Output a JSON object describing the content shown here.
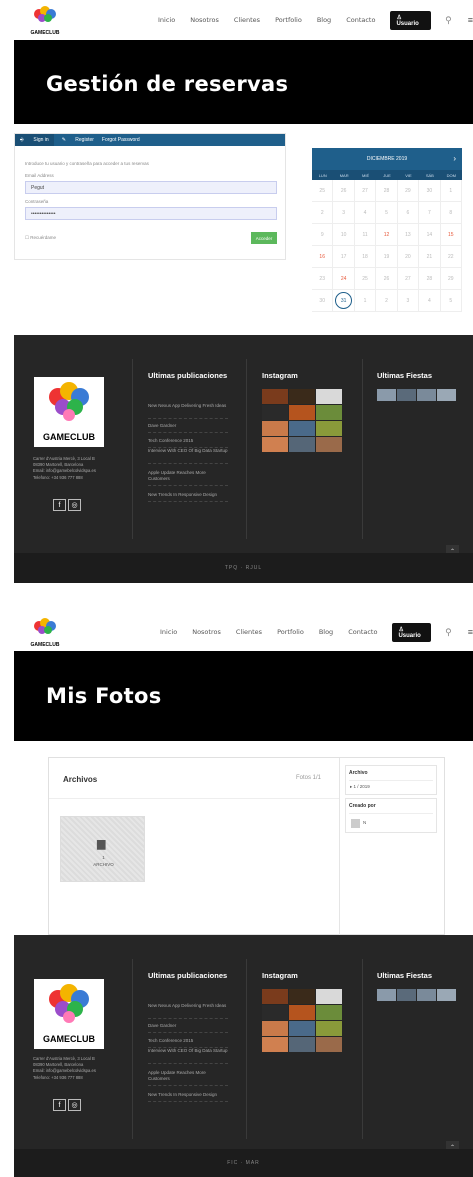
{
  "nav": {
    "items": [
      "Inicio",
      "Nosotros",
      "Clientes",
      "Portfolio",
      "Blog",
      "Contacto"
    ],
    "user_button": "Usuario",
    "logo_text": "GAMECLUB"
  },
  "page1": {
    "title": "Gestión de reservas"
  },
  "login": {
    "tabs": [
      "Sign in",
      "Register",
      "Forgot Password"
    ],
    "intro": "Introduce tu usuario y contraseña para acceder a tus reservas",
    "email_label": "Email Address",
    "email_value": "Pegut",
    "password_label": "Contraseña",
    "password_value": "••••••••••••••",
    "remember": "Recuérdame",
    "submit": "Acceder"
  },
  "calendar": {
    "month": "DICIEMBRE 2019",
    "days": [
      "LUN",
      "MAR",
      "MIÉ",
      "JUE",
      "VIE",
      "SÁB",
      "DOM"
    ],
    "cells": [
      "25",
      "26",
      "27",
      "28",
      "29",
      "30",
      "1",
      "2",
      "3",
      "4",
      "5",
      "6",
      "7",
      "8",
      "9",
      "10",
      "11",
      "12",
      "13",
      "14",
      "15",
      "16",
      "17",
      "18",
      "19",
      "20",
      "21",
      "22",
      "23",
      "24",
      "25",
      "26",
      "27",
      "28",
      "29",
      "30",
      "31",
      "1",
      "2",
      "3",
      "4",
      "5"
    ],
    "highlight_color": "#e85a3c",
    "accent": "#1f5f8b"
  },
  "footer": {
    "col_posts_title": "Ultimas publicaciones",
    "posts": [
      "New Nexus App Delivering Fresh Ideas",
      "Dave Gardner",
      "Tech Conference 2015",
      "Interview With CEO Of Big Data Startup",
      "Apple Update Reaches More Customers",
      "New Trends In Responsive Design"
    ],
    "col_ig_title": "Instagram",
    "col_fiestas_title": "Ultimas Fiestas",
    "info": [
      "Carrer d'Austria Mercè, 3 Local B",
      "08390 Martorell, Barcelona",
      "Email: info@gamebelcolvidspa.es",
      "Telefono: +34 936 777 888"
    ],
    "logo_text": "GAMECLUB",
    "bar1": "TPQ · RJUL",
    "bar2": "FIC · MAR"
  },
  "page2": {
    "title": "Mis Fotos"
  },
  "files": {
    "title": "Archivos",
    "count": "Fotos 1/1",
    "folder_count": "1",
    "folder_label": "ARCHIVO",
    "side_archive": "Archivo",
    "side_year": "▸ 1 / 2019",
    "side_created": "Creado por",
    "side_user": "N"
  }
}
